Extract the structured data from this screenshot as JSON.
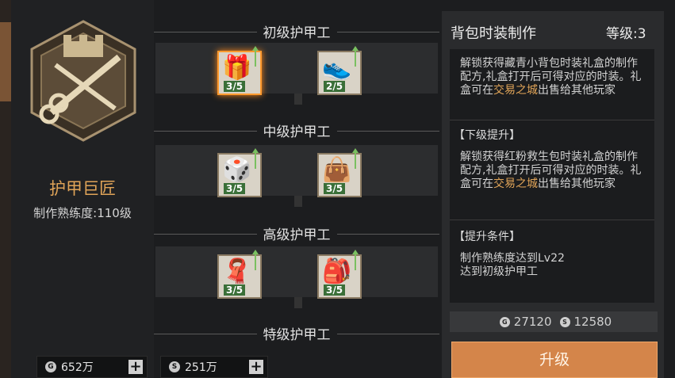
{
  "profile": {
    "title": "护甲巨匠",
    "proficiency": "制作熟练度:110级"
  },
  "currencies": [
    {
      "icon": "coin-icon",
      "value": "652万"
    },
    {
      "icon": "silver-icon",
      "value": "251万"
    }
  ],
  "tiers": [
    {
      "name": "初级护甲工",
      "items": [
        {
          "icon": "gift-box-icon",
          "count": "3/5"
        },
        {
          "icon": "sneakers-icon",
          "count": "2/5"
        }
      ]
    },
    {
      "name": "中级护甲工",
      "items": [
        {
          "icon": "dice-icon",
          "count": "3/5"
        },
        {
          "icon": "bag-icon",
          "count": "3/5"
        }
      ]
    },
    {
      "name": "高级护甲工",
      "items": [
        {
          "icon": "cloth-icon",
          "count": "3/5"
        },
        {
          "icon": "backpack-icon",
          "count": "3/5"
        }
      ]
    },
    {
      "name": "特级护甲工",
      "items": []
    }
  ],
  "detail": {
    "title": "背包时装制作",
    "level": "等级:3",
    "current_desc_a": "解锁获得藏青小背包时装礼盒的制作配方,礼盒打开后可得对应的时装。礼盒可在",
    "current_desc_link": "交易之城",
    "current_desc_b": "出售给其他玩家",
    "next_header": "【下级提升】",
    "next_desc_a": "解锁获得红粉救生包时装礼盒的制作配方,礼盒打开后可得对应的时装。礼盒可在",
    "next_desc_link": "交易之城",
    "next_desc_b": "出售给其他玩家",
    "cond_header": "【提升条件】",
    "cond_1": "制作熟练度达到Lv22",
    "cond_2": "达到初级护甲工"
  },
  "cost": {
    "coin": "27120",
    "silver": "12580"
  },
  "upgrade_label": "升级",
  "colors": {
    "accent": "#e0a458",
    "button": "#d4854a",
    "count_bg": "#286428"
  }
}
